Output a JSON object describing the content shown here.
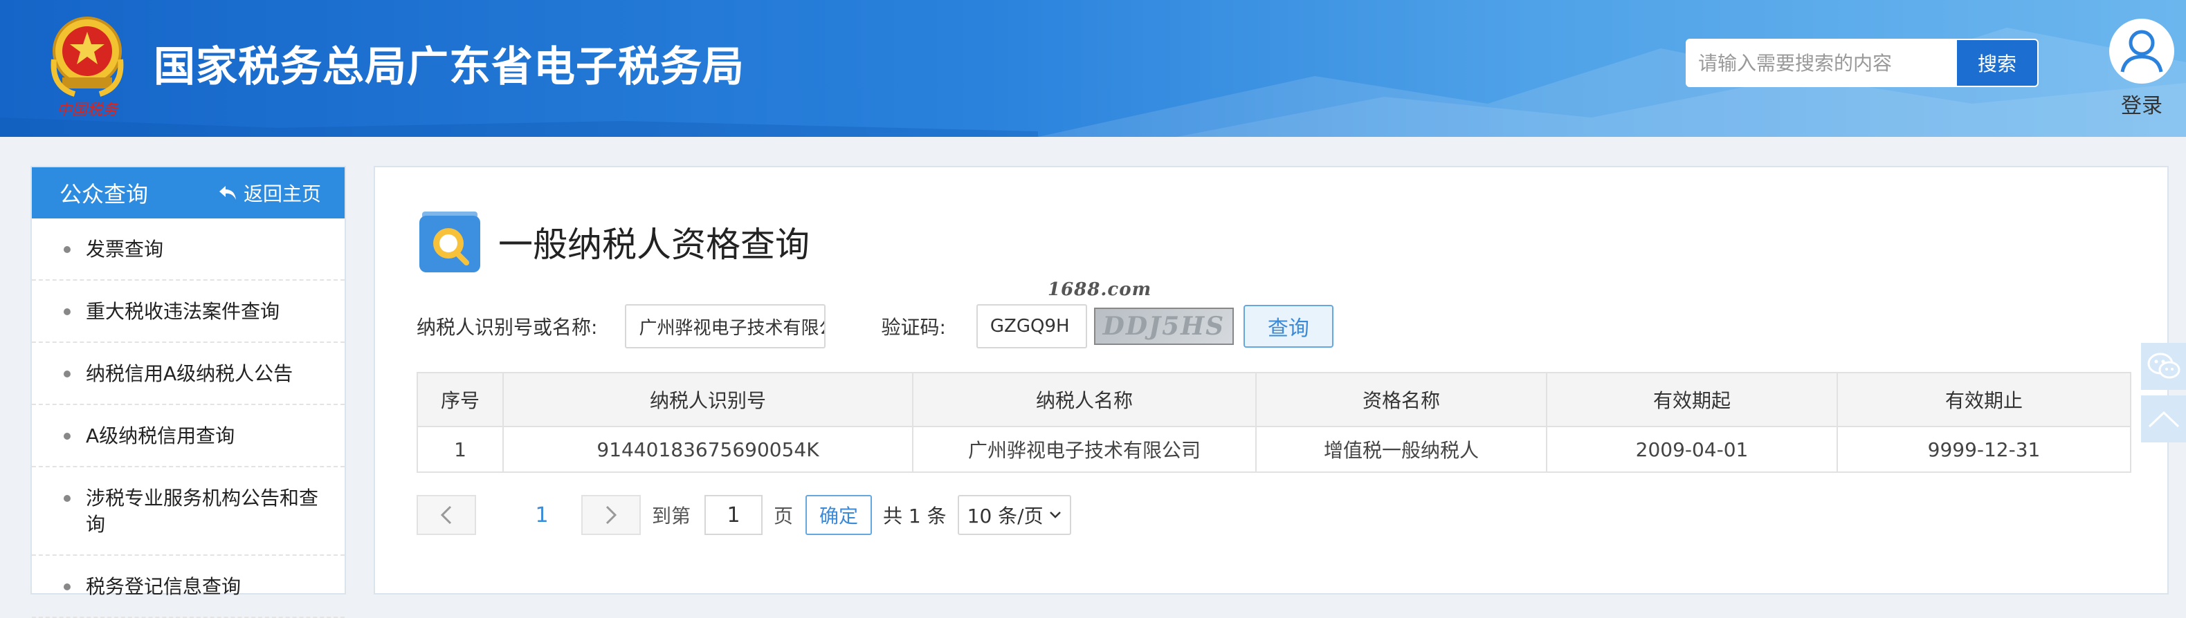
{
  "header": {
    "emblem_text": "中国税务",
    "title": "国家税务总局广东省电子税务局",
    "search_placeholder": "请输入需要搜索的内容",
    "search_button": "搜索",
    "login_label": "登录"
  },
  "sidebar": {
    "title": "公众查询",
    "back_label": "返回主页",
    "items": [
      {
        "label": "发票查询"
      },
      {
        "label": "重大税收违法案件查询"
      },
      {
        "label": "纳税信用A级纳税人公告"
      },
      {
        "label": "A级纳税信用查询"
      },
      {
        "label": "涉税专业服务机构公告和查询"
      },
      {
        "label": "税务登记信息查询"
      }
    ]
  },
  "main": {
    "page_title": "一般纳税人资格查询",
    "watermark": "1688.com",
    "form": {
      "taxpayer_label": "纳税人识别号或名称:",
      "taxpayer_value": "广州骅视电子技术有限公",
      "captcha_label": "验证码:",
      "captcha_value": "GZGQ9H",
      "captcha_image_text": "DDJ5HS",
      "query_button": "查询"
    },
    "table": {
      "headers": [
        "序号",
        "纳税人识别号",
        "纳税人名称",
        "资格名称",
        "有效期起",
        "有效期止"
      ],
      "rows": [
        [
          "1",
          "91440183675690054K",
          "广州骅视电子技术有限公司",
          "增值税一般纳税人",
          "2009-04-01",
          "9999-12-31"
        ]
      ]
    },
    "pager": {
      "current_page": "1",
      "goto_label": "到第",
      "goto_value": "1",
      "page_unit": "页",
      "confirm": "确定",
      "total": "共 1 条",
      "page_size": "10 条/页"
    }
  },
  "colors": {
    "header_blue": "#2a82dc",
    "accent": "#2d8ce0",
    "link": "#3a8dd8"
  }
}
